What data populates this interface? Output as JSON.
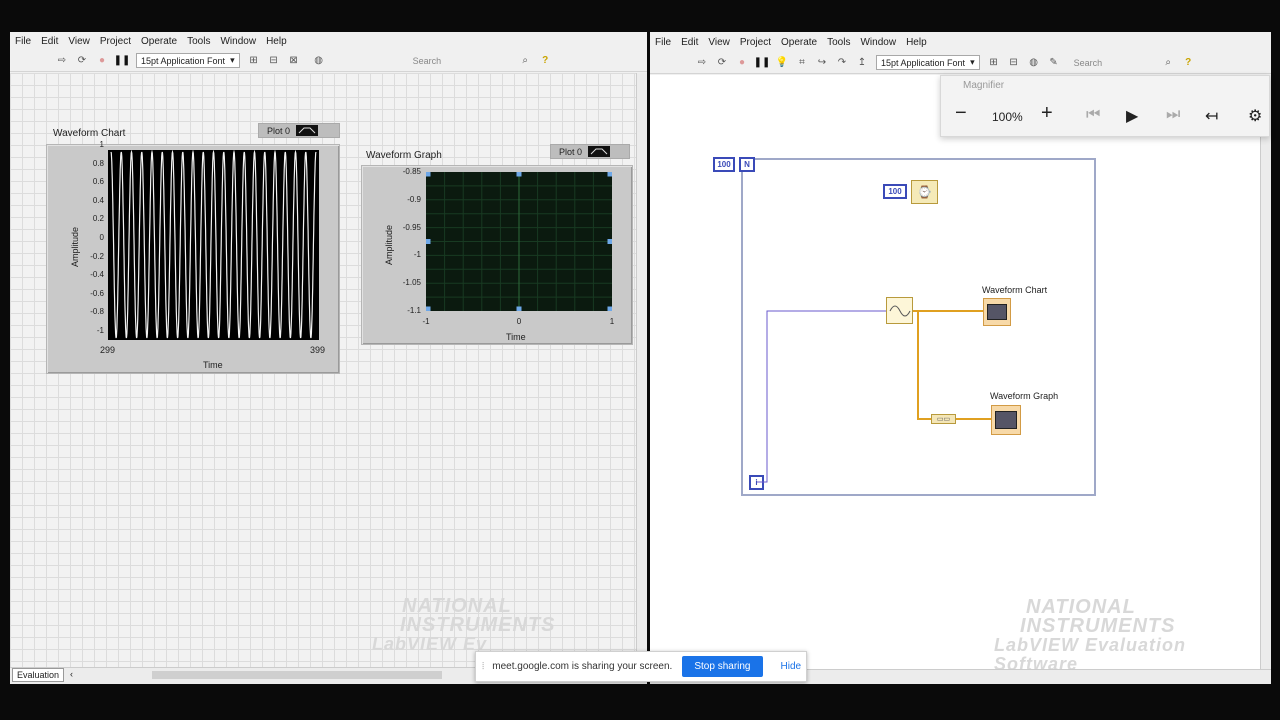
{
  "front_panel": {
    "menu": [
      "File",
      "Edit",
      "View",
      "Project",
      "Operate",
      "Tools",
      "Window",
      "Help"
    ],
    "font": "15pt Application Font",
    "search_placeholder": "Search",
    "chart": {
      "title": "Waveform Chart",
      "legend": "Plot 0",
      "ylabel": "Amplitude",
      "xlabel": "Time",
      "yticks": [
        "1",
        "0.8",
        "0.6",
        "0.4",
        "0.2",
        "0",
        "-0.2",
        "-0.4",
        "-0.6",
        "-0.8",
        "-1"
      ],
      "xstart": "299",
      "xend": "399"
    },
    "graph": {
      "title": "Waveform Graph",
      "legend": "Plot 0",
      "ylabel": "Amplitude",
      "xlabel": "Time",
      "yticks": [
        "-0.85",
        "-0.9",
        "-0.95",
        "-1",
        "-1.05",
        "-1.1"
      ],
      "xticks": [
        "-1",
        "0",
        "1"
      ]
    },
    "status": "Evaluation",
    "watermark_1": "NATIONAL",
    "watermark_2": "INSTRUMENTS",
    "watermark_3": "LabVIEW Ev"
  },
  "block_diagram": {
    "menu": [
      "File",
      "Edit",
      "View",
      "Project",
      "Operate",
      "Tools",
      "Window",
      "Help"
    ],
    "font": "15pt Application Font",
    "search_placeholder": "Search",
    "loop_count": "100",
    "loop_n": "N",
    "wait_const": "100",
    "loop_i": "i",
    "chart_label": "Waveform Chart",
    "graph_label": "Waveform Graph",
    "watermark_1": "NATIONAL",
    "watermark_2": "INSTRUMENTS",
    "watermark_3": "LabVIEW Evaluation Software"
  },
  "magnifier": {
    "title": "Magnifier",
    "zoom": "100%"
  },
  "share_bar": {
    "message": "meet.google.com is sharing your screen.",
    "stop": "Stop sharing",
    "hide": "Hide"
  },
  "chart_data": [
    {
      "type": "line",
      "title": "Waveform Chart",
      "xlabel": "Time",
      "ylabel": "Amplitude",
      "xlim": [
        299,
        399
      ],
      "ylim": [
        -1,
        1
      ],
      "series": [
        {
          "name": "Plot 0",
          "cycles": 20,
          "amplitude": 1
        }
      ]
    },
    {
      "type": "line",
      "title": "Waveform Graph",
      "xlabel": "Time",
      "ylabel": "Amplitude",
      "xlim": [
        -1,
        1
      ],
      "ylim": [
        -1.1,
        -0.85
      ],
      "series": [
        {
          "name": "Plot 0",
          "values": []
        }
      ]
    }
  ]
}
